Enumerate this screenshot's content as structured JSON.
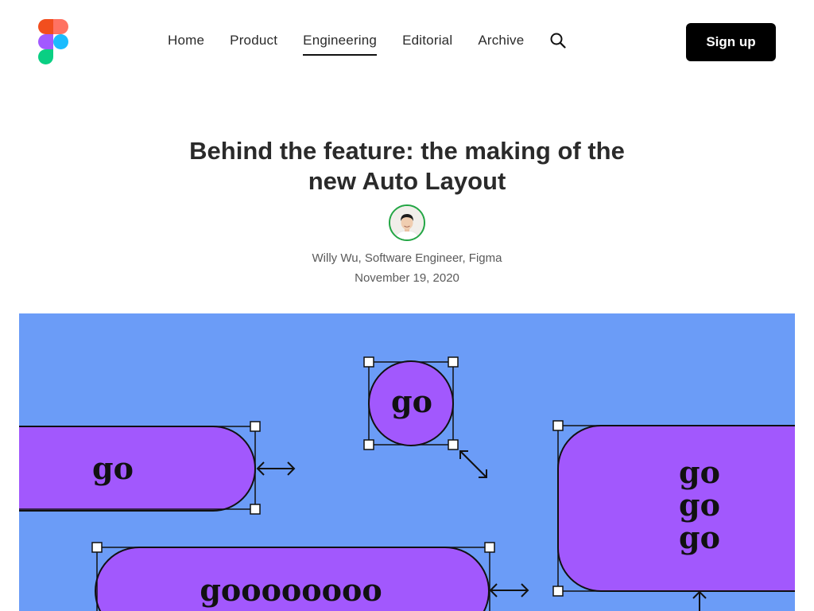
{
  "nav": {
    "items": [
      {
        "label": "Home",
        "active": false
      },
      {
        "label": "Product",
        "active": false
      },
      {
        "label": "Engineering",
        "active": true
      },
      {
        "label": "Editorial",
        "active": false
      },
      {
        "label": "Archive",
        "active": false
      }
    ],
    "search_icon": "search-icon",
    "signup_label": "Sign up"
  },
  "article": {
    "title_line1": "Behind the feature: the making of the",
    "title_line2": "new Auto Layout",
    "author": "Willy Wu, Software Engineer, Figma",
    "date": "November 19, 2020"
  },
  "hero": {
    "pill_left": "go",
    "circle": "go",
    "pill_bottom": "goooooooo",
    "stack": [
      "go",
      "go",
      "go"
    ]
  },
  "colors": {
    "hero_bg": "#6b9cf7",
    "shape_fill": "#a258fd",
    "avatar_ring": "#23a645",
    "signup_bg": "#000000"
  }
}
